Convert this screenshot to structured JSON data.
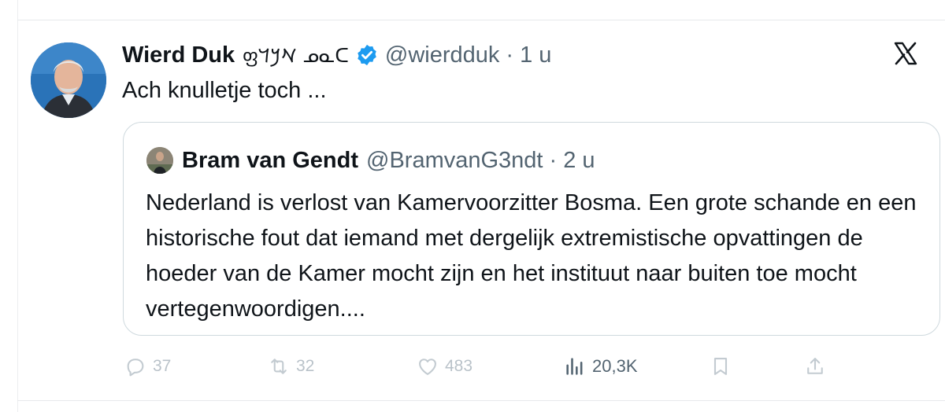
{
  "tweet": {
    "author_name": "Wierd Duk",
    "author_script": "ფ𐡀𐡊𐡃 ᓄᓇᑕ",
    "author_handle": "@wierdduk",
    "time": "· 1 u",
    "text": "Ach knulletje toch ..."
  },
  "quote": {
    "author_name": "Bram van Gendt",
    "author_handle": "@BramvanG3ndt",
    "time": "· 2 u",
    "text": "Nederland is verlost van Kamervoorzitter Bosma. Een grote schande en een historische fout dat iemand met dergelijk extremistische opvattingen de hoeder van de Kamer mocht zijn en het instituut naar buiten toe mocht vertegenwoordigen...."
  },
  "actions": {
    "replies": "37",
    "reposts": "32",
    "likes": "483",
    "views": "20,3K"
  },
  "icons": {
    "verified": "verified-badge-icon",
    "brand": "x-logo-icon",
    "reply": "reply-icon",
    "repost": "repost-icon",
    "like": "heart-icon",
    "views": "views-icon",
    "bookmark": "bookmark-icon",
    "share": "share-icon"
  },
  "colors": {
    "verified": "#1d9bf0",
    "muted_text": "#536471",
    "faded_action": "#b9c2c9",
    "border": "#cfd9de"
  }
}
